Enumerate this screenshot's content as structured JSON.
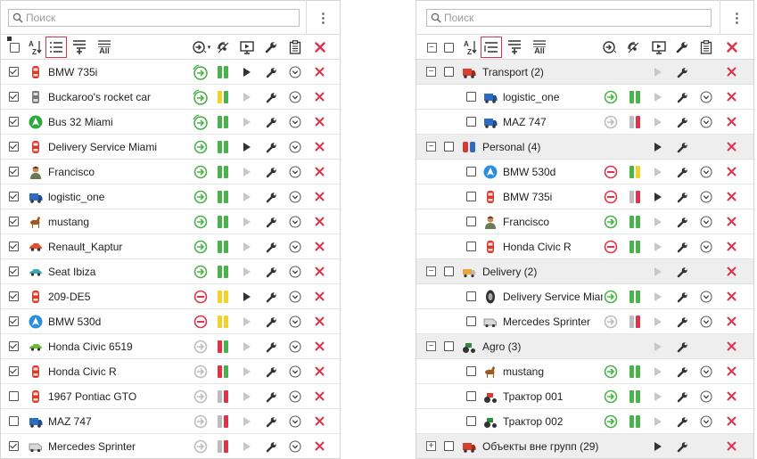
{
  "search": {
    "placeholder": "Поиск"
  },
  "menu": {
    "label": "⋮"
  },
  "colors": {
    "green": "#49b24a",
    "red": "#e0334a",
    "yellow": "#f2d12c",
    "grey": "#bdbdbd",
    "selected_border": "#e0334a"
  },
  "icon_names": {
    "search": "search-icon",
    "sort": "sort-az-icon",
    "list": "list-view-icon",
    "group": "group-view-icon",
    "add_group": "add-group-icon",
    "all": "show-all-icon",
    "connection": "connection-state-icon",
    "gps": "gps-state-icon",
    "monitor": "commands-icon",
    "tools": "wrench-icon",
    "report": "report-icon",
    "delete": "delete-icon",
    "play": "play-track-icon",
    "nav": "navigate-icon"
  },
  "left_panel": {
    "toolbar": {
      "sort_label": "A↓Z",
      "all_label": "All"
    },
    "units": [
      {
        "name": "BMW 735i",
        "icon": "car-red",
        "checked": true,
        "conn": "green-active",
        "sig": [
          "green",
          "green"
        ],
        "play": true,
        "nav": true
      },
      {
        "name": "Buckaroo's rocket car",
        "icon": "car-grey",
        "checked": true,
        "conn": "green-active",
        "sig": [
          "yellow",
          "green"
        ],
        "play": false,
        "nav": true
      },
      {
        "name": "Bus 32 Miami",
        "icon": "bus-green",
        "checked": true,
        "conn": "green-active",
        "sig": [
          "green",
          "green"
        ],
        "play": false,
        "nav": true
      },
      {
        "name": "Delivery Service Miami",
        "icon": "car-red",
        "checked": true,
        "conn": "green",
        "sig": [
          "green",
          "green"
        ],
        "play": true,
        "nav": true
      },
      {
        "name": "Francisco",
        "icon": "person",
        "checked": true,
        "conn": "green",
        "sig": [
          "green",
          "green"
        ],
        "play": false,
        "nav": true
      },
      {
        "name": "logistic_one",
        "icon": "truck-blue",
        "checked": true,
        "conn": "green",
        "sig": [
          "green",
          "green"
        ],
        "play": false,
        "nav": true
      },
      {
        "name": "mustang",
        "icon": "horse",
        "checked": true,
        "conn": "green",
        "sig": [
          "green",
          "green"
        ],
        "play": false,
        "nav": true
      },
      {
        "name": "Renault_Kaptur",
        "icon": "car-orange",
        "checked": true,
        "conn": "green",
        "sig": [
          "green",
          "green"
        ],
        "play": false,
        "nav": true
      },
      {
        "name": "Seat Ibiza",
        "icon": "car-teal",
        "checked": true,
        "conn": "green",
        "sig": [
          "green",
          "green"
        ],
        "play": false,
        "nav": true
      },
      {
        "name": "209-DE5",
        "icon": "car-red",
        "checked": true,
        "conn": "red",
        "sig": [
          "yellow",
          "yellow"
        ],
        "play": true,
        "nav": true
      },
      {
        "name": "BMW 530d",
        "icon": "arrow-blue",
        "checked": true,
        "conn": "red",
        "sig": [
          "yellow",
          "yellow"
        ],
        "play": false,
        "nav": true
      },
      {
        "name": "Honda Civic 6519",
        "icon": "car-green",
        "checked": true,
        "conn": "grey",
        "sig": [
          "red",
          "green"
        ],
        "play": false,
        "nav": true
      },
      {
        "name": "Honda Civic R",
        "icon": "car-red",
        "checked": true,
        "conn": "grey",
        "sig": [
          "red",
          "green"
        ],
        "play": false,
        "nav": true
      },
      {
        "name": "1967 Pontiac GTO",
        "icon": "car-red",
        "checked": false,
        "conn": "grey",
        "sig": [
          "grey",
          "red"
        ],
        "play": false,
        "nav": true
      },
      {
        "name": "MAZ 747",
        "icon": "truck-blue",
        "checked": false,
        "conn": "grey",
        "sig": [
          "grey",
          "red"
        ],
        "play": false,
        "nav": true
      },
      {
        "name": "Mercedes Sprinter",
        "icon": "van-grey",
        "checked": true,
        "conn": "grey",
        "sig": [
          "grey",
          "red"
        ],
        "play": false,
        "nav": true
      }
    ]
  },
  "right_panel": {
    "toolbar": {
      "sort_label": "A↓Z",
      "all_label": "All"
    },
    "rows": [
      {
        "type": "group",
        "name": "Transport (2)",
        "icon": "truck-red",
        "expanded": true,
        "play": false
      },
      {
        "type": "unit",
        "name": "logistic_one",
        "icon": "truck-blue",
        "conn": "green",
        "sig": [
          "green",
          "green"
        ],
        "play": false
      },
      {
        "type": "unit",
        "name": "MAZ 747",
        "icon": "truck-blue",
        "conn": "grey",
        "sig": [
          "grey",
          "red"
        ],
        "play": false
      },
      {
        "type": "group",
        "name": "Personal (4)",
        "icon": "people",
        "expanded": true,
        "play": true
      },
      {
        "type": "unit",
        "name": "BMW 530d",
        "icon": "arrow-blue",
        "conn": "red",
        "sig": [
          "green",
          "yellow"
        ],
        "play": false
      },
      {
        "type": "unit",
        "name": "BMW 735i",
        "icon": "car-red",
        "conn": "red",
        "sig": [
          "grey",
          "red"
        ],
        "play": true
      },
      {
        "type": "unit",
        "name": "Francisco",
        "icon": "person",
        "conn": "green",
        "sig": [
          "green",
          "green"
        ],
        "play": false
      },
      {
        "type": "unit",
        "name": "Honda Civic R",
        "icon": "car-red",
        "conn": "red",
        "sig": [
          "green",
          "green"
        ],
        "play": false
      },
      {
        "type": "group",
        "name": "Delivery (2)",
        "icon": "truck-orange",
        "expanded": true,
        "play": false
      },
      {
        "type": "unit",
        "name": "Delivery Service Miami",
        "icon": "tire",
        "conn": "green",
        "sig": [
          "green",
          "green"
        ],
        "play": false
      },
      {
        "type": "unit",
        "name": "Mercedes Sprinter",
        "icon": "van-grey",
        "conn": "grey",
        "sig": [
          "grey",
          "red"
        ],
        "play": false
      },
      {
        "type": "group",
        "name": "Agro (3)",
        "icon": "tractor",
        "expanded": true,
        "play": false
      },
      {
        "type": "unit",
        "name": "mustang",
        "icon": "horse",
        "conn": "green",
        "sig": [
          "green",
          "green"
        ],
        "play": false
      },
      {
        "type": "unit",
        "name": "Трактор 001",
        "icon": "tractor-red",
        "conn": "green",
        "sig": [
          "green",
          "green"
        ],
        "play": false
      },
      {
        "type": "unit",
        "name": "Трактор 002",
        "icon": "tractor",
        "conn": "green",
        "sig": [
          "green",
          "green"
        ],
        "play": false
      },
      {
        "type": "group",
        "name": "Объекты вне групп (29)",
        "icon": "truck-red",
        "expanded": false,
        "play": true
      }
    ]
  }
}
